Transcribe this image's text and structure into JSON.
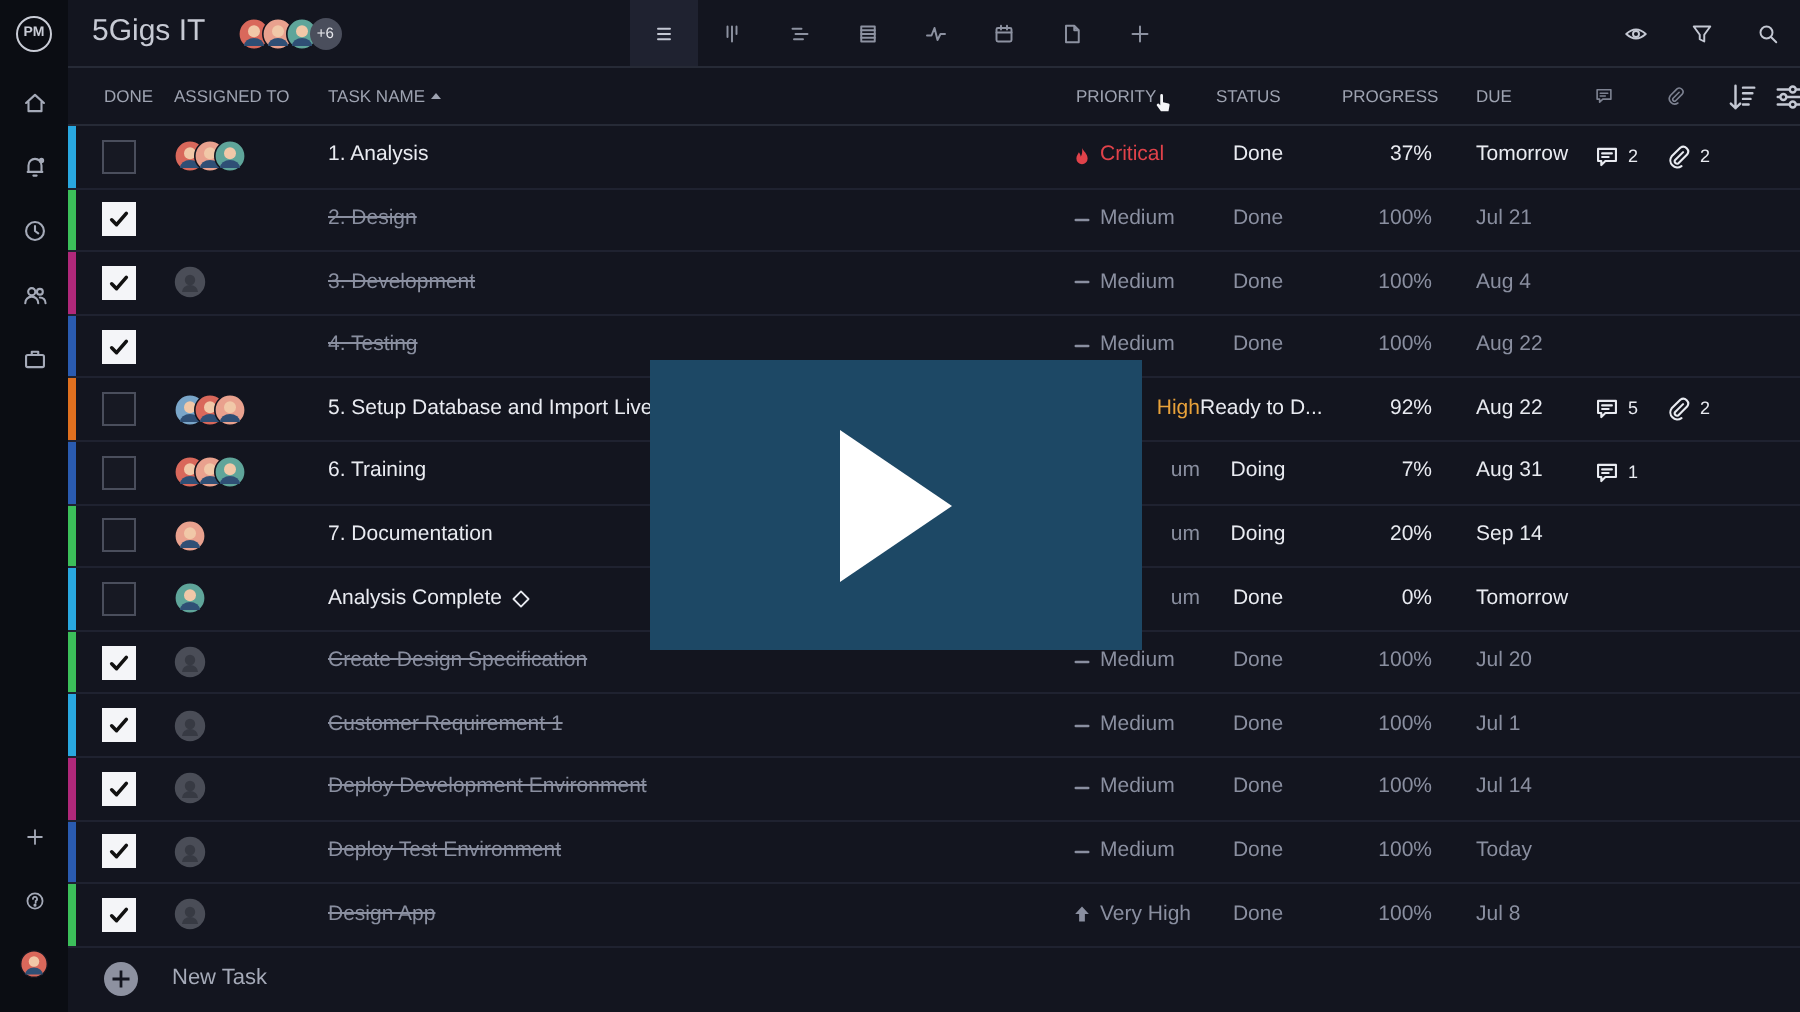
{
  "sidebar": {
    "logo": "PM",
    "top_items": [
      {
        "kind": "home"
      },
      {
        "kind": "bell"
      },
      {
        "kind": "clock"
      },
      {
        "kind": "people"
      },
      {
        "kind": "briefcase"
      }
    ],
    "bottom_items": [
      {
        "kind": "plus"
      },
      {
        "kind": "help"
      },
      {
        "kind": "avatar"
      }
    ]
  },
  "topbar": {
    "project": "5Gigs IT",
    "members": [
      {
        "kind": "photo"
      },
      {
        "kind": "photo"
      },
      {
        "kind": "photo"
      }
    ],
    "members_more": "+6",
    "views": [
      {
        "kind": "list",
        "selected": true
      },
      {
        "kind": "board",
        "selected": false
      },
      {
        "kind": "gantt",
        "selected": false
      },
      {
        "kind": "table",
        "selected": false
      },
      {
        "kind": "pulse",
        "selected": false
      },
      {
        "kind": "calendar",
        "selected": false
      },
      {
        "kind": "file",
        "selected": false
      },
      {
        "kind": "plus",
        "selected": false
      }
    ],
    "actions": [
      {
        "kind": "eye"
      },
      {
        "kind": "filter"
      },
      {
        "kind": "search"
      }
    ]
  },
  "table": {
    "columns": [
      "DONE",
      "ASSIGNED TO",
      "TASK NAME",
      "PRIORITY",
      "STATUS",
      "PROGRESS",
      "DUE"
    ],
    "rows": [
      {
        "color": "#29a8e0",
        "done": false,
        "assignees": [
          {
            "kind": "photo"
          },
          {
            "kind": "photo"
          },
          {
            "kind": "photo"
          }
        ],
        "name": "1. Analysis",
        "priority": {
          "text": "Critical",
          "kind": "critical",
          "icon": true
        },
        "status": "Done",
        "progress": "37%",
        "due": "Tomorrow",
        "comments": "2",
        "attachments": "2"
      },
      {
        "color": "#3cbf5a",
        "done": true,
        "assignees": [],
        "name": "2. Design",
        "priority": {
          "text": "Medium",
          "kind": "medium",
          "icon": true
        },
        "status": "Done",
        "progress": "100%",
        "due": "Jul 21"
      },
      {
        "color": "#b0287a",
        "done": true,
        "assignees": [
          {
            "kind": "placeholder"
          }
        ],
        "name": "3. Development",
        "priority": {
          "text": "Medium",
          "kind": "medium",
          "icon": true
        },
        "status": "Done",
        "progress": "100%",
        "due": "Aug 4"
      },
      {
        "color": "#2a5bb0",
        "done": true,
        "assignees": [],
        "name": "4. Testing",
        "priority": {
          "text": "Medium",
          "kind": "medium",
          "icon": true
        },
        "status": "Done",
        "progress": "100%",
        "due": "Aug 22"
      },
      {
        "color": "#e0701f",
        "done": false,
        "assignees": [
          {
            "kind": "photo"
          },
          {
            "kind": "photo"
          },
          {
            "kind": "photo"
          }
        ],
        "name": "5. Setup Database and Import Live",
        "priority": {
          "text": "High",
          "kind": "very-high",
          "icon": false
        },
        "status": "Ready to D...",
        "progress": "92%",
        "due": "Aug 22",
        "comments": "5",
        "attachments": "2"
      },
      {
        "color": "#2a5bb0",
        "done": false,
        "assignees": [
          {
            "kind": "photo"
          },
          {
            "kind": "photo"
          },
          {
            "kind": "photo"
          }
        ],
        "name": "6. Training",
        "priority": {
          "text": "um",
          "kind": "medium",
          "icon": false
        },
        "status": "Doing",
        "progress": "7%",
        "due": "Aug 31",
        "comments": "1"
      },
      {
        "color": "#3cbf5a",
        "done": false,
        "assignees": [
          {
            "kind": "photo"
          }
        ],
        "name": "7. Documentation",
        "priority": {
          "text": "um",
          "kind": "medium",
          "icon": false
        },
        "status": "Doing",
        "progress": "20%",
        "due": "Sep 14"
      },
      {
        "color": "#29a8e0",
        "done": false,
        "assignees": [
          {
            "kind": "photo"
          }
        ],
        "name": "Analysis Complete",
        "milestone": true,
        "priority": {
          "text": "um",
          "kind": "medium",
          "icon": false
        },
        "status": "Done",
        "progress": "0%",
        "due": "Tomorrow"
      },
      {
        "color": "#3cbf5a",
        "done": true,
        "assignees": [
          {
            "kind": "placeholder"
          }
        ],
        "name": "Create Design Specification",
        "priority": {
          "text": "Medium",
          "kind": "medium",
          "icon": true
        },
        "status": "Done",
        "progress": "100%",
        "due": "Jul 20"
      },
      {
        "color": "#29a8e0",
        "done": true,
        "assignees": [
          {
            "kind": "placeholder"
          }
        ],
        "name": "Customer Requirement 1",
        "priority": {
          "text": "Medium",
          "kind": "medium",
          "icon": true
        },
        "status": "Done",
        "progress": "100%",
        "due": "Jul 1"
      },
      {
        "color": "#b0287a",
        "done": true,
        "assignees": [
          {
            "kind": "placeholder"
          }
        ],
        "name": "Deploy Development Environment",
        "priority": {
          "text": "Medium",
          "kind": "medium",
          "icon": true
        },
        "status": "Done",
        "progress": "100%",
        "due": "Jul 14"
      },
      {
        "color": "#2a5bb0",
        "done": true,
        "assignees": [
          {
            "kind": "placeholder"
          }
        ],
        "name": "Deploy Test Environment",
        "priority": {
          "text": "Medium",
          "kind": "medium",
          "icon": true
        },
        "status": "Done",
        "progress": "100%",
        "due": "Today"
      },
      {
        "color": "#3cbf5a",
        "done": true,
        "assignees": [
          {
            "kind": "placeholder"
          }
        ],
        "name": "Design App",
        "priority": {
          "text": "Very High",
          "kind": "very-high",
          "icon": true
        },
        "status": "Done",
        "progress": "100%",
        "due": "Jul 8"
      }
    ],
    "new_task": "New Task"
  },
  "video_overlay": {
    "kind": "play"
  }
}
